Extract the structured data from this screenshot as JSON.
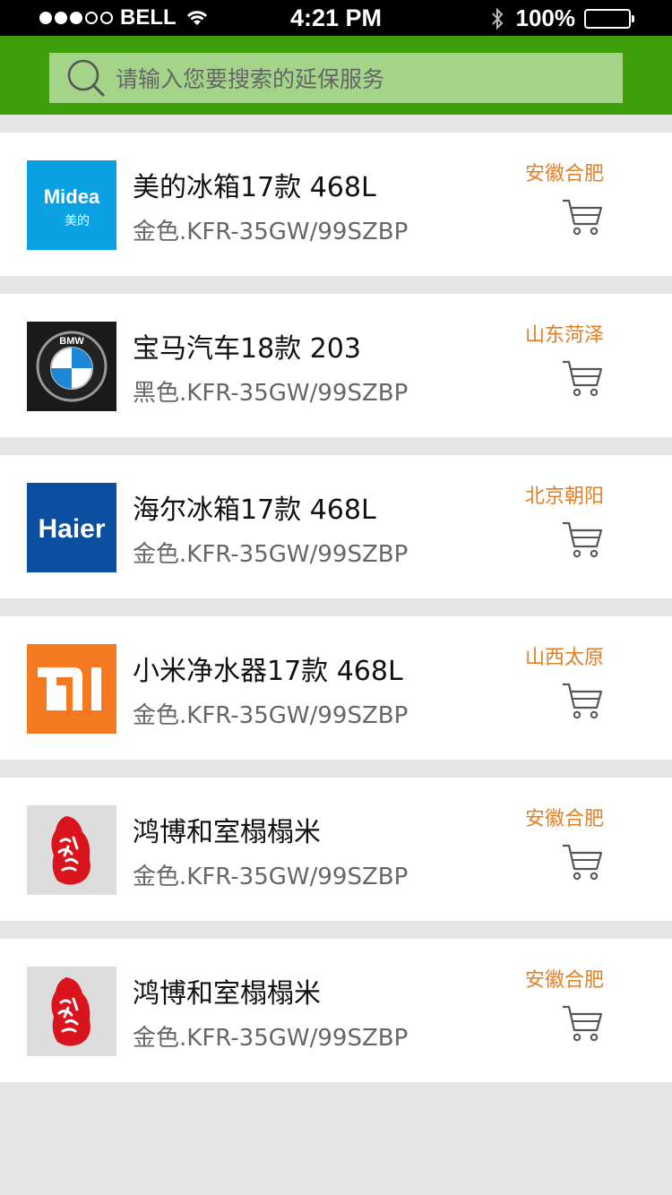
{
  "status": {
    "carrier": "BELL",
    "time": "4:21 PM",
    "battery": "100%"
  },
  "search": {
    "placeholder": "请输入您要搜索的延保服务"
  },
  "items": [
    {
      "title": "美的冰箱17款 468L",
      "sub": "金色.KFR-35GW/99SZBP",
      "location": "安徽合肥",
      "logo": "midea",
      "logo_text": "Midea",
      "logo_sub": "美的",
      "logo_color": "#0aa1e2"
    },
    {
      "title": "宝马汽车18款 203",
      "sub": "黑色.KFR-35GW/99SZBP",
      "location": "山东菏泽",
      "logo": "bmw",
      "logo_text": "BMW",
      "logo_color": "#1a1a1a"
    },
    {
      "title": "海尔冰箱17款 468L",
      "sub": "金色.KFR-35GW/99SZBP",
      "location": "北京朝阳",
      "logo": "haier",
      "logo_text": "Haier",
      "logo_color": "#0a4fa0"
    },
    {
      "title": "小米净水器17款 468L",
      "sub": "金色.KFR-35GW/99SZBP",
      "location": "山西太原",
      "logo": "mi",
      "logo_color": "#f47920"
    },
    {
      "title": "鸿博和室榻榻米",
      "sub": "金色.KFR-35GW/99SZBP",
      "location": "安徽合肥",
      "logo": "seal",
      "logo_color": "#dddddd"
    },
    {
      "title": "鸿博和室榻榻米",
      "sub": "金色.KFR-35GW/99SZBP",
      "location": "安徽合肥",
      "logo": "seal",
      "logo_color": "#dddddd"
    }
  ],
  "colors": {
    "header": "#3f9e0b",
    "location": "#e07f25"
  },
  "icons": {
    "search": "search-icon",
    "cart": "cart-icon"
  }
}
